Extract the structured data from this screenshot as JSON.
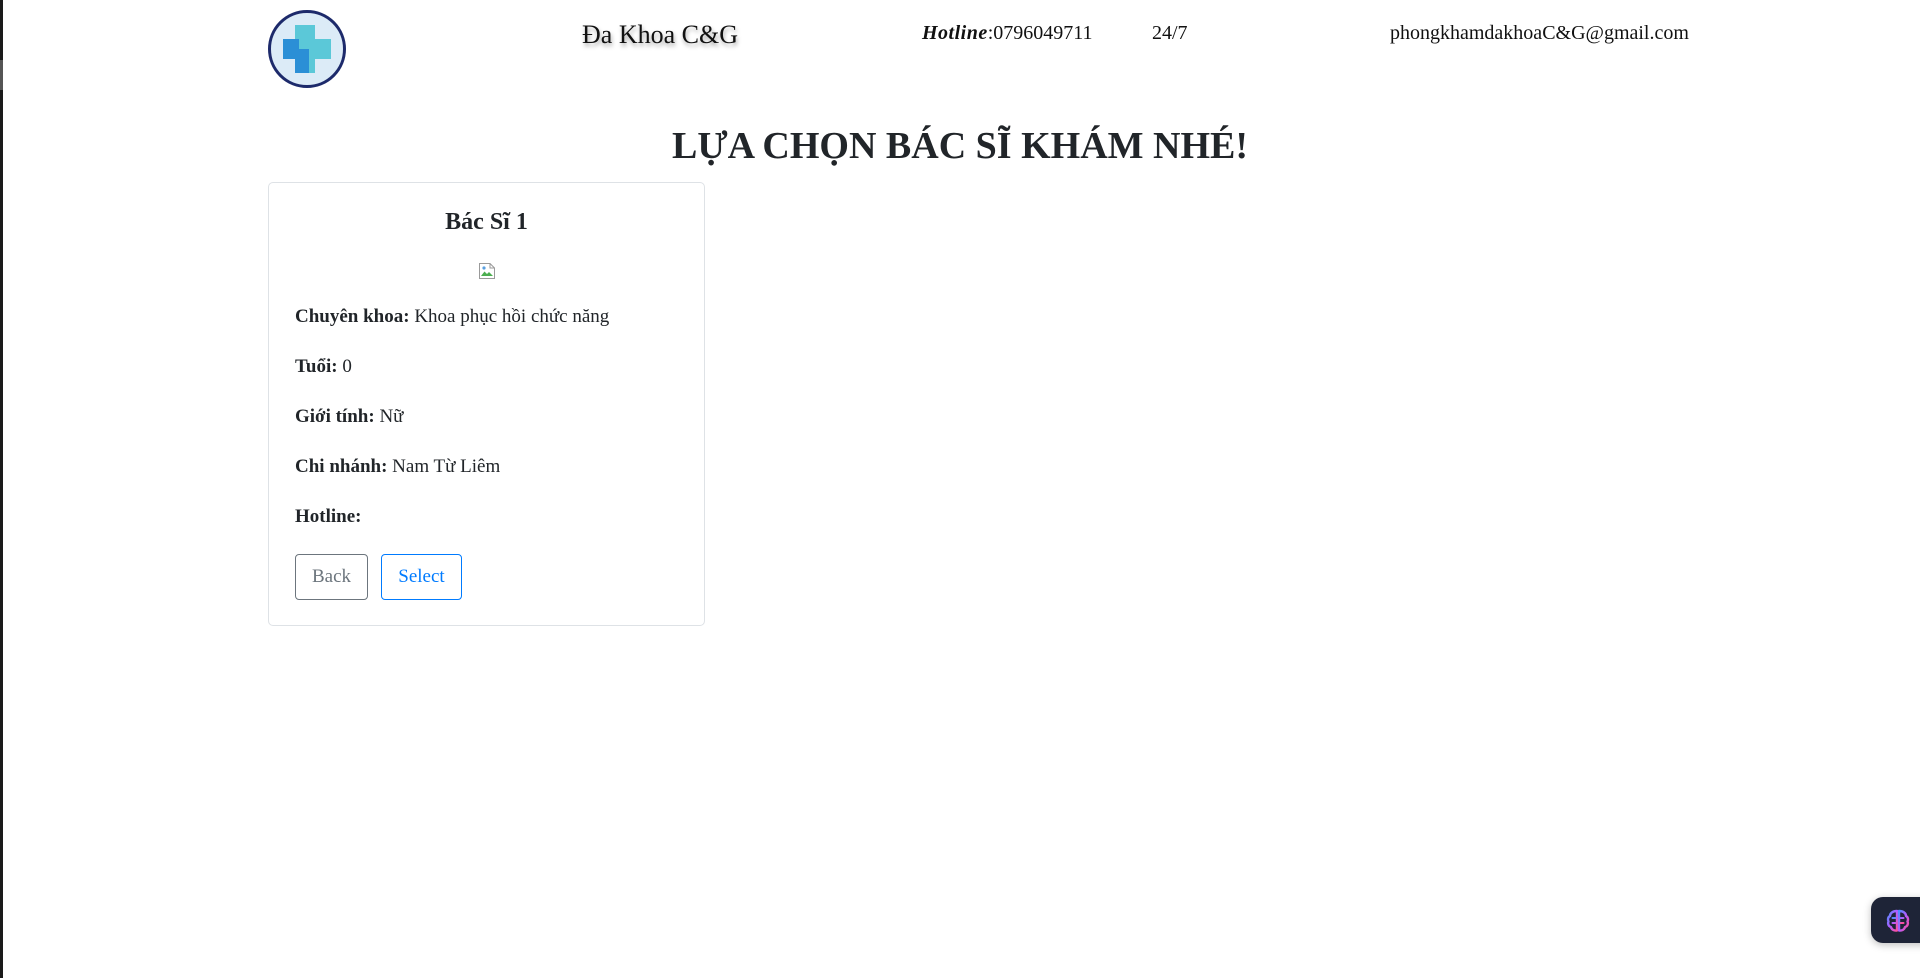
{
  "header": {
    "brand": "Đa Khoa C&G",
    "hotline_label": "Hotline",
    "hotline_separator": ":",
    "hotline_number": "0796049711",
    "hours": "24/7",
    "email": "phongkhamdakhoaC&G@gmail.com",
    "logo_icon": "medical-cross-icon"
  },
  "page": {
    "title": "LỰA CHỌN BÁC SĨ KHÁM NHÉ!"
  },
  "doctor_card": {
    "name": "Bác Sĩ 1",
    "image_icon": "broken-image-icon",
    "fields": {
      "specialty_label": "Chuyên khoa:",
      "specialty_value": "Khoa phục hồi chức năng",
      "age_label": "Tuổi:",
      "age_value": "0",
      "gender_label": "Giới tính:",
      "gender_value": "Nữ",
      "branch_label": "Chi nhánh:",
      "branch_value": "Nam Từ Liêm",
      "hotline_label": "Hotline:",
      "hotline_value": ""
    },
    "back_label": "Back",
    "select_label": "Select"
  },
  "widget": {
    "icon": "brain-icon"
  },
  "colors": {
    "primary": "#007bff",
    "secondary": "#6c757d",
    "logo_border": "#1d2a6b",
    "logo_cross_light": "#5bc8d8",
    "logo_cross_dark": "#2b8fd6",
    "widget_bg": "#1e2437"
  }
}
